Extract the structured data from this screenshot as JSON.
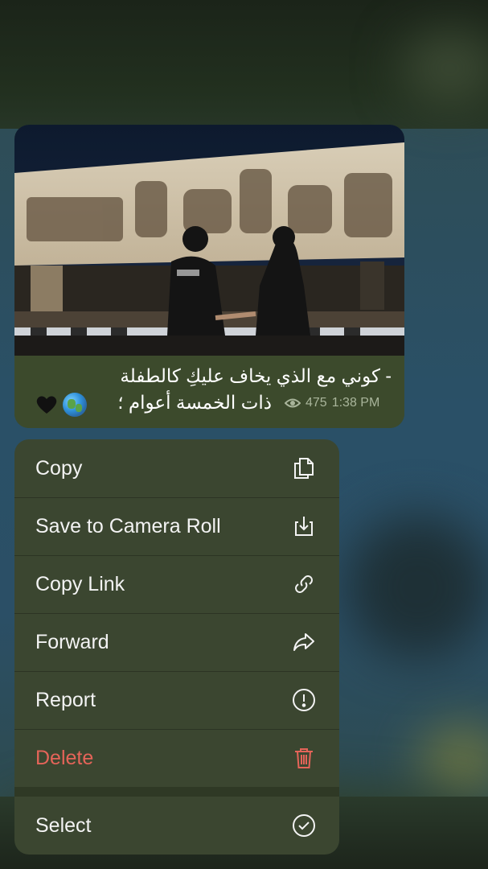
{
  "message": {
    "caption_line1": "- كوني مع الذي يخاف عليكِ كالطفلة",
    "caption_line2": "ذات الخمسة أعوام ؛",
    "emoji": [
      "globe-emoji",
      "black-heart-emoji"
    ],
    "views": "475",
    "time": "1:38 PM"
  },
  "menu": {
    "items": [
      {
        "label": "Copy",
        "icon": "copy-icon"
      },
      {
        "label": "Save to Camera Roll",
        "icon": "save-icon"
      },
      {
        "label": "Copy Link",
        "icon": "link-icon"
      },
      {
        "label": "Forward",
        "icon": "forward-icon"
      },
      {
        "label": "Report",
        "icon": "report-icon"
      },
      {
        "label": "Delete",
        "icon": "trash-icon",
        "color": "#e56459"
      }
    ],
    "select": {
      "label": "Select",
      "icon": "check-circle-icon"
    }
  },
  "colors": {
    "menu_bg": "#3b4630",
    "bubble_bg": "#3c4a2c",
    "danger": "#e56459",
    "meta_text": "#a9b59b"
  }
}
